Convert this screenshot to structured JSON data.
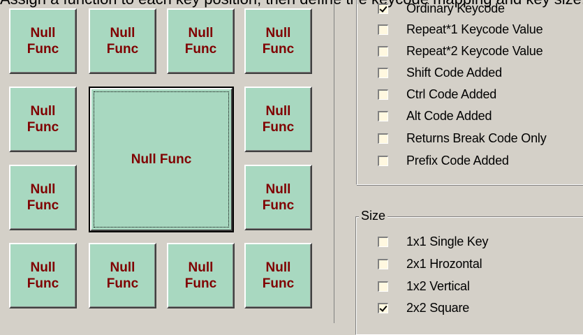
{
  "caption": "Assign a function to each key position, then define the keycode mapping and key size.",
  "keys": {
    "label": "Null\nFunc",
    "big_label": "Null Func"
  },
  "options": [
    {
      "label": "Ordinary Keycode",
      "checked": true
    },
    {
      "label": "Repeat*1 Keycode Value",
      "checked": false
    },
    {
      "label": "Repeat*2 Keycode Value",
      "checked": false
    },
    {
      "label": "Shift Code Added",
      "checked": false
    },
    {
      "label": "Ctrl Code Added",
      "checked": false
    },
    {
      "label": "Alt Code Added",
      "checked": false
    },
    {
      "label": "Returns Break Code Only",
      "checked": false
    },
    {
      "label": "Prefix Code Added",
      "checked": false
    }
  ],
  "size": {
    "legend": "Size",
    "options": [
      {
        "label": "1x1 Single Key",
        "checked": false
      },
      {
        "label": "2x1 Hrozontal",
        "checked": false
      },
      {
        "label": "1x2 Vertical",
        "checked": false
      },
      {
        "label": "2x2 Square",
        "checked": true
      }
    ]
  }
}
